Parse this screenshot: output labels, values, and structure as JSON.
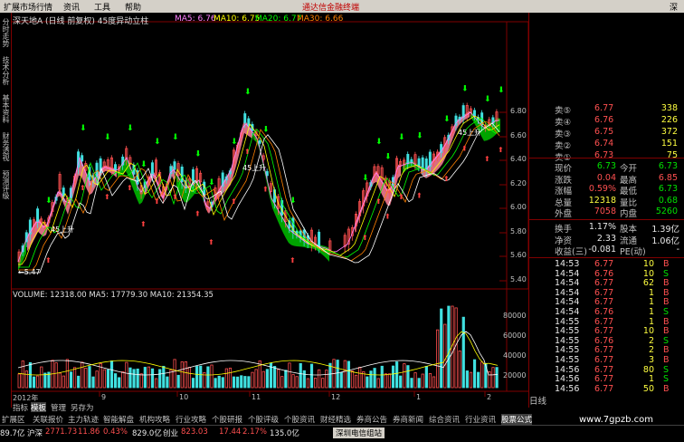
{
  "menubar": {
    "items": [
      "扩展市场行情",
      "资讯",
      "工具",
      "帮助"
    ],
    "ad_text": "通达信金融终端",
    "close_glyph": "深"
  },
  "sidebar": {
    "tabs": [
      "分时走势",
      "技术分析",
      "基本资料",
      "财务透视",
      "预测评级"
    ]
  },
  "chart": {
    "title": "深天地A (日线 前复权) 45度异动立柱",
    "ma_legend": [
      {
        "label": "MA5: 6.76",
        "color": "#ff80ff"
      },
      {
        "label": "MA10: 6.75",
        "color": "#ffff00"
      },
      {
        "label": "MA20: 6.77",
        "color": "#00ff00"
      },
      {
        "label": "MA30: 6.66",
        "color": "#ff8000"
      }
    ],
    "price_ticks": [
      "6.80",
      "6.60",
      "6.40",
      "6.20",
      "6.00",
      "5.80",
      "5.60",
      "5.40"
    ],
    "annotations": [
      "45上升",
      "45上升",
      "45上升",
      "←5.47"
    ],
    "volume_legend": "VOLUME: 12318.00  MA5: 17779.30  MA10: 21354.35",
    "volume_ticks": [
      "80000",
      "60000",
      "40000",
      "20000"
    ],
    "date_labels": [
      "2012年",
      "9",
      "10",
      "11",
      "12",
      "1",
      "2"
    ]
  },
  "quote": {
    "asks": [
      {
        "label": "卖⑤",
        "price": "6.77",
        "vol": "338"
      },
      {
        "label": "卖④",
        "price": "6.76",
        "vol": "226"
      },
      {
        "label": "卖③",
        "price": "6.75",
        "vol": "372"
      },
      {
        "label": "卖②",
        "price": "6.74",
        "vol": "151"
      },
      {
        "label": "卖①",
        "price": "6.73",
        "vol": "75"
      }
    ],
    "stats": [
      {
        "l1": "现价",
        "v1": "6.73",
        "c1": "grn",
        "l2": "今开",
        "v2": "6.73",
        "c2": "grn"
      },
      {
        "l1": "涨跌",
        "v1": "0.04",
        "c1": "red",
        "l2": "最高",
        "v2": "6.85",
        "c2": "red"
      },
      {
        "l1": "涨幅",
        "v1": "0.59%",
        "c1": "red",
        "l2": "最低",
        "v2": "6.73",
        "c2": "grn"
      },
      {
        "l1": "总量",
        "v1": "12318",
        "c1": "yel",
        "l2": "量比",
        "v2": "0.68",
        "c2": "grn"
      },
      {
        "l1": "外盘",
        "v1": "7058",
        "c1": "red",
        "l2": "内盘",
        "v2": "5260",
        "c2": "grn"
      }
    ],
    "stats2": [
      {
        "l1": "换手",
        "v1": "1.17%",
        "l2": "股本",
        "v2": "1.39亿"
      },
      {
        "l1": "净资",
        "v1": "2.33",
        "l2": "流通",
        "v2": "1.06亿"
      },
      {
        "l1": "收益(三)",
        "v1": "-0.081",
        "l2": "PE(动)",
        "v2": "-"
      }
    ],
    "ticks": [
      {
        "time": "14:53",
        "price": "6.77",
        "vol": "10",
        "side": "B"
      },
      {
        "time": "14:54",
        "price": "6.76",
        "vol": "10",
        "side": "S"
      },
      {
        "time": "14:54",
        "price": "6.77",
        "vol": "62",
        "side": "B"
      },
      {
        "time": "14:54",
        "price": "6.77",
        "vol": "1",
        "side": "B"
      },
      {
        "time": "14:54",
        "price": "6.77",
        "vol": "1",
        "side": "B"
      },
      {
        "time": "14:54",
        "price": "6.76",
        "vol": "1",
        "side": "S"
      },
      {
        "time": "14:55",
        "price": "6.77",
        "vol": "1",
        "side": "B"
      },
      {
        "time": "14:55",
        "price": "6.77",
        "vol": "10",
        "side": "B"
      },
      {
        "time": "14:55",
        "price": "6.76",
        "vol": "2",
        "side": "S"
      },
      {
        "time": "14:55",
        "price": "6.77",
        "vol": "2",
        "side": "B"
      },
      {
        "time": "14:55",
        "price": "6.77",
        "vol": "3",
        "side": "B"
      },
      {
        "time": "14:56",
        "price": "6.77",
        "vol": "80",
        "side": "S"
      },
      {
        "time": "14:56",
        "price": "6.77",
        "vol": "1",
        "side": "S"
      },
      {
        "time": "14:56",
        "price": "6.77",
        "vol": "50",
        "side": "B"
      }
    ],
    "period_label": "日线"
  },
  "bottom_tabs": {
    "row1": [
      "指标",
      "模板",
      "管理",
      "另存为"
    ],
    "row2": [
      "扩展区",
      "关联报价",
      "主力轨迹",
      "智能解盘",
      "机构攻略",
      "行业攻略",
      "个股研报",
      "个股评级",
      "个股资讯",
      "财经精选",
      "券商公告",
      "券商新闻",
      "综合资讯",
      "行业资讯",
      "股票公式"
    ]
  },
  "statusbar": {
    "left": "89.7亿",
    "sh_label": "沪深",
    "sh_value": "2771.73",
    "sh_change": "11.86",
    "sh_pct": "0.43%",
    "amt": "829.0亿",
    "cy_label": "创业",
    "cy_value": "823.03",
    "cy_change": "17.44",
    "cy_pct": "2.17%",
    "cy_amt": "135.0亿",
    "station": "深圳电信组站",
    "watermark": "www.7gpzb.com"
  }
}
